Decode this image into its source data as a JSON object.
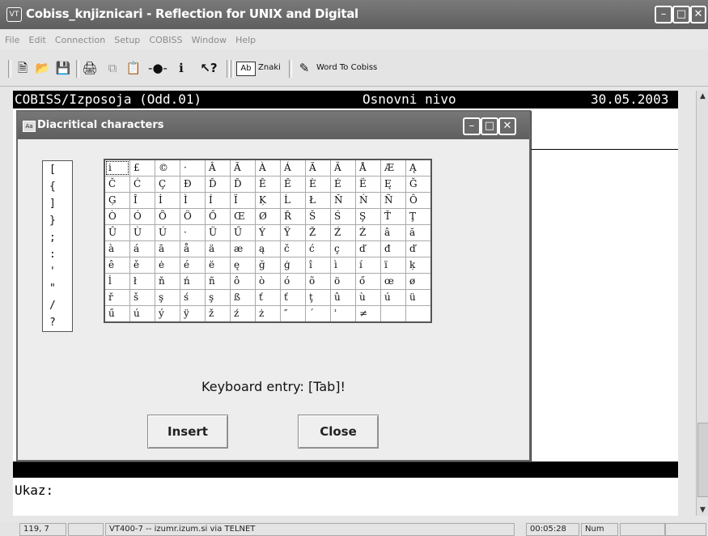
{
  "window": {
    "title": "Cobiss_knjiznicari - Reflection for UNIX and Digital",
    "icon": "VT"
  },
  "menu": [
    "File",
    "Edit",
    "Connection",
    "Setup",
    "COBISS",
    "Window",
    "Help"
  ],
  "toolbar": {
    "znaki_label": "Znaki",
    "word_label": "Word To Cobiss",
    "znaki_icon_text": "Ab"
  },
  "terminal": {
    "header_left": "COBISS/Izposoja (Odd.01)",
    "header_mid": "Osnovni nivo",
    "header_right": "30.05.2003",
    "prompt": "Ukaz:"
  },
  "dialog": {
    "title": "Diacritical characters",
    "left_chars": [
      "[",
      "{",
      "]",
      "}",
      ";",
      ":",
      "'",
      "\"",
      "/",
      "?"
    ],
    "grid": [
      [
        "i",
        "£",
        "©",
        "·",
        "Â",
        "Ã",
        "À",
        "Á",
        "Ã",
        "Ä",
        "Å",
        "Æ",
        "Ą"
      ],
      [
        "Č",
        "Ć",
        "Ç",
        "Đ",
        "Ď",
        "Ď",
        "Ê",
        "Ě",
        "È",
        "É",
        "Ë",
        "Ę",
        "Ğ"
      ],
      [
        "Ģ",
        "Î",
        "İ",
        "Ì",
        "Í",
        "Ï",
        "Ķ",
        "Ĺ",
        "Ł",
        "Ň",
        "Ń",
        "Ñ",
        "Ô"
      ],
      [
        "Ò",
        "Ó",
        "Õ",
        "Ö",
        "Ő",
        "Œ",
        "Ø",
        "Ř",
        "Š",
        "Ś",
        "Ş",
        "Ť",
        "Ţ"
      ],
      [
        "Û",
        "Ù",
        "Ú",
        "·",
        "Ü",
        "Ű",
        "Ý",
        "Ÿ",
        "Ž",
        "Ź",
        "Ż",
        "â",
        "ă"
      ],
      [
        "à",
        "á",
        "ā",
        "å",
        "ä",
        "æ",
        "ą",
        "č",
        "ć",
        "ç",
        "ď",
        "đ",
        "ď"
      ],
      [
        "ê",
        "ě",
        "ė",
        "é",
        "ë",
        "ę",
        "ğ",
        "ģ",
        "î",
        "ì",
        "í",
        "ï",
        "ķ"
      ],
      [
        "ĺ",
        "ł",
        "ň",
        "ń",
        "ñ",
        "ô",
        "ò",
        "ó",
        "õ",
        "ö",
        "ő",
        "œ",
        "ø"
      ],
      [
        "ř",
        "š",
        "ş",
        "ś",
        "ş",
        "ß",
        "ť",
        "ť",
        "ţ",
        "û",
        "ù",
        "ú",
        "ü"
      ],
      [
        "ű",
        "ú",
        "ý",
        "ÿ",
        "ž",
        "ź",
        "ż",
        "″",
        "ˊ",
        "ʾ",
        "≠",
        "",
        ""
      ]
    ],
    "keyboard_entry": "Keyboard entry: [Tab]!",
    "insert_label": "Insert",
    "close_label": "Close"
  },
  "statusbar": {
    "cursor": "119, 7",
    "connection": "VT400-7 -- izumr.izum.si via TELNET",
    "time": "00:05:28",
    "num": "Num"
  }
}
